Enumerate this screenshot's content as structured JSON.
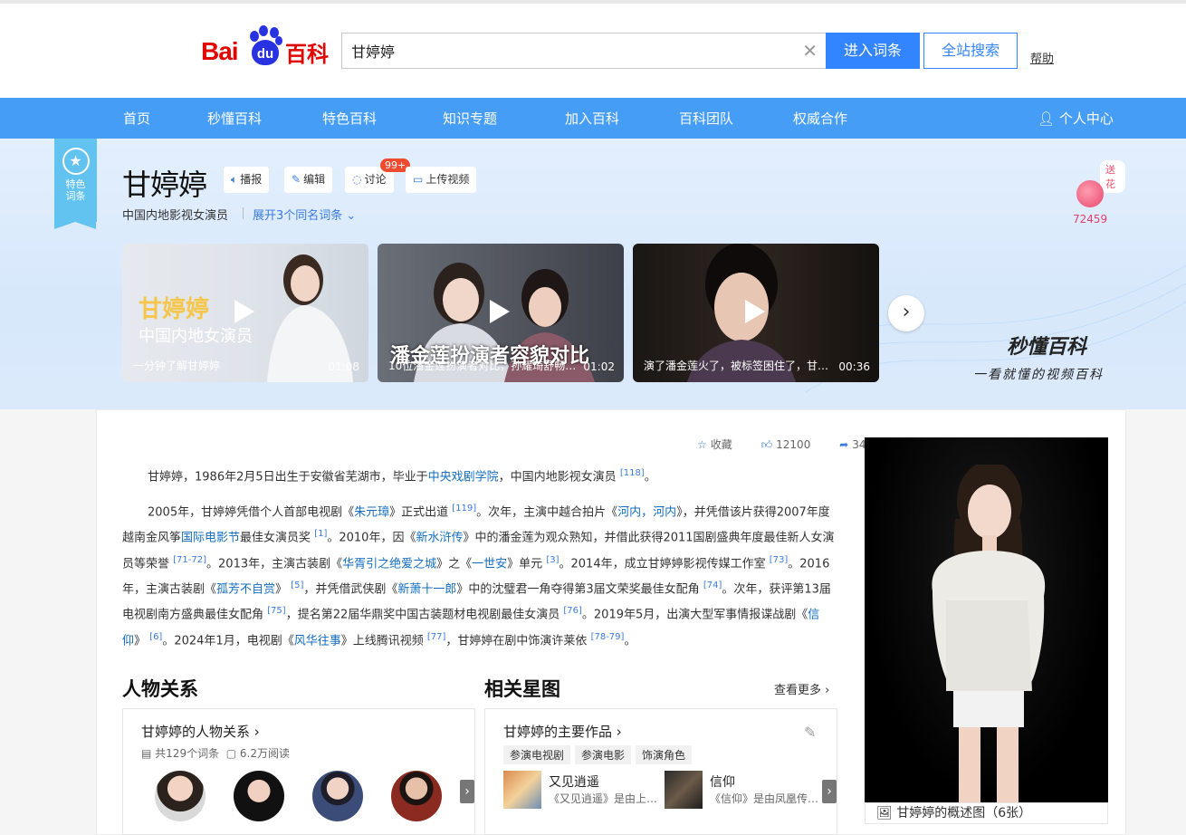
{
  "header": {
    "logo": {
      "bai": "Bai",
      "du": "du",
      "baike": "百科"
    },
    "search_value": "甘婷婷",
    "clear_icon": "close-icon",
    "enter_label": "进入词条",
    "site_search_label": "全站搜索",
    "help_label": "帮助"
  },
  "nav": {
    "items": [
      "首页",
      "秒懂百科",
      "特色百科",
      "知识专题",
      "加入百科",
      "百科团队",
      "权威合作"
    ],
    "user_label": "个人中心"
  },
  "entry": {
    "ribbon": {
      "line1": "特色",
      "line2": "词条"
    },
    "title": "甘婷婷",
    "buttons": {
      "broadcast": "播报",
      "edit": "编辑",
      "discuss": "讨论",
      "upload": "上传视频"
    },
    "discuss_badge": "99+",
    "subtitle": "中国内地影视女演员",
    "expand_label": "展开3个同名词条",
    "flower": {
      "tag": "送花",
      "count": "72459"
    }
  },
  "videos": [
    {
      "caption": "一分钟了解甘婷婷",
      "duration": "01:08",
      "overlay1": "甘婷婷",
      "overlay2": "中国内地女演员"
    },
    {
      "caption": "10位潘金莲扮演者对比，孙耀琦舒畅…",
      "duration": "01:02",
      "overlay": "潘金莲扮演者容貌对比"
    },
    {
      "caption": "演了潘金莲火了，被标签困住了，甘…",
      "duration": "00:36"
    }
  ],
  "miaodong": {
    "logo": "秒懂百科",
    "slogan": "一看就懂的视频百科"
  },
  "actions": {
    "favorite": "收藏",
    "likes": "12100",
    "shares": "347"
  },
  "summary": {
    "p1_pre": "甘婷婷，1986年2月5日出生于安徽省芜湖市，毕业于",
    "p1_link": "中央戏剧学院",
    "p1_post": "，中国内地影视女演员",
    "p1_ref": "[118]",
    "p1_end": "。",
    "p2": [
      {
        "t": "2005年，甘婷婷凭借个人首部电视剧《"
      },
      {
        "l": "朱元璋"
      },
      {
        "t": "》正式出道"
      },
      {
        "r": "[119]"
      },
      {
        "t": "。次年，主演中越合拍片《"
      },
      {
        "l": "河内，河内"
      },
      {
        "t": "》，并凭借该片获得2007年度越南金风筝"
      },
      {
        "l": "国际电影节"
      },
      {
        "t": "最佳女演员奖"
      },
      {
        "r": "[1]"
      },
      {
        "t": "。2010年，因《"
      },
      {
        "l": "新水浒传"
      },
      {
        "t": "》中的潘金莲为观众熟知，并借此获得2011国剧盛典年度最佳新人女演员等荣誉"
      },
      {
        "r": "[71-72]"
      },
      {
        "t": "。2013年，主演古装剧《"
      },
      {
        "l": "华胥引之绝爱之城"
      },
      {
        "t": "》之《"
      },
      {
        "l": "一世安"
      },
      {
        "t": "》单元"
      },
      {
        "r": "[3]"
      },
      {
        "t": "。2014年，成立甘婷婷影视传媒工作室"
      },
      {
        "r": "[73]"
      },
      {
        "t": "。2016年，主演古装剧《"
      },
      {
        "l": "孤芳不自赏"
      },
      {
        "t": "》"
      },
      {
        "r": "[5]"
      },
      {
        "t": "，并凭借武侠剧《"
      },
      {
        "l": "新萧十一郎"
      },
      {
        "t": "》中的沈璧君一角夺得第3届文荣奖最佳女配角"
      },
      {
        "r": "[74]"
      },
      {
        "t": "。次年，获评第13届电视剧南方盛典最佳女配角"
      },
      {
        "r": "[75]"
      },
      {
        "t": "，提名第22届华鼎奖中国古装题材电视剧最佳女演员"
      },
      {
        "r": "[76]"
      },
      {
        "t": "。2019年5月，出演大型军事情报谍战剧《"
      },
      {
        "l": "信仰"
      },
      {
        "t": "》"
      },
      {
        "r": "[6]"
      },
      {
        "t": "。2024年1月，电视剧《"
      },
      {
        "l": "风华往事"
      },
      {
        "t": "》上线腾讯视频"
      },
      {
        "r": "[77]"
      },
      {
        "t": "，甘婷婷在剧中饰演许莱依"
      },
      {
        "r": "[78-79]"
      },
      {
        "t": "。"
      }
    ]
  },
  "photo_caption": "甘婷婷的概述图（6张）",
  "relations": {
    "heading": "人物关系",
    "card_title": "甘婷婷的人物关系",
    "count": "共129个词条",
    "reads": "6.2万阅读"
  },
  "stars": {
    "heading": "相关星图",
    "more": "查看更多",
    "card_title": "甘婷婷的主要作品",
    "chips": [
      "参演电视剧",
      "参演电影",
      "饰演角色"
    ],
    "works": [
      {
        "title": "又见逍遥",
        "desc": "《又见逍遥》是由上…"
      },
      {
        "title": "信仰",
        "desc": "《信仰》是由凤凰传…"
      }
    ]
  }
}
